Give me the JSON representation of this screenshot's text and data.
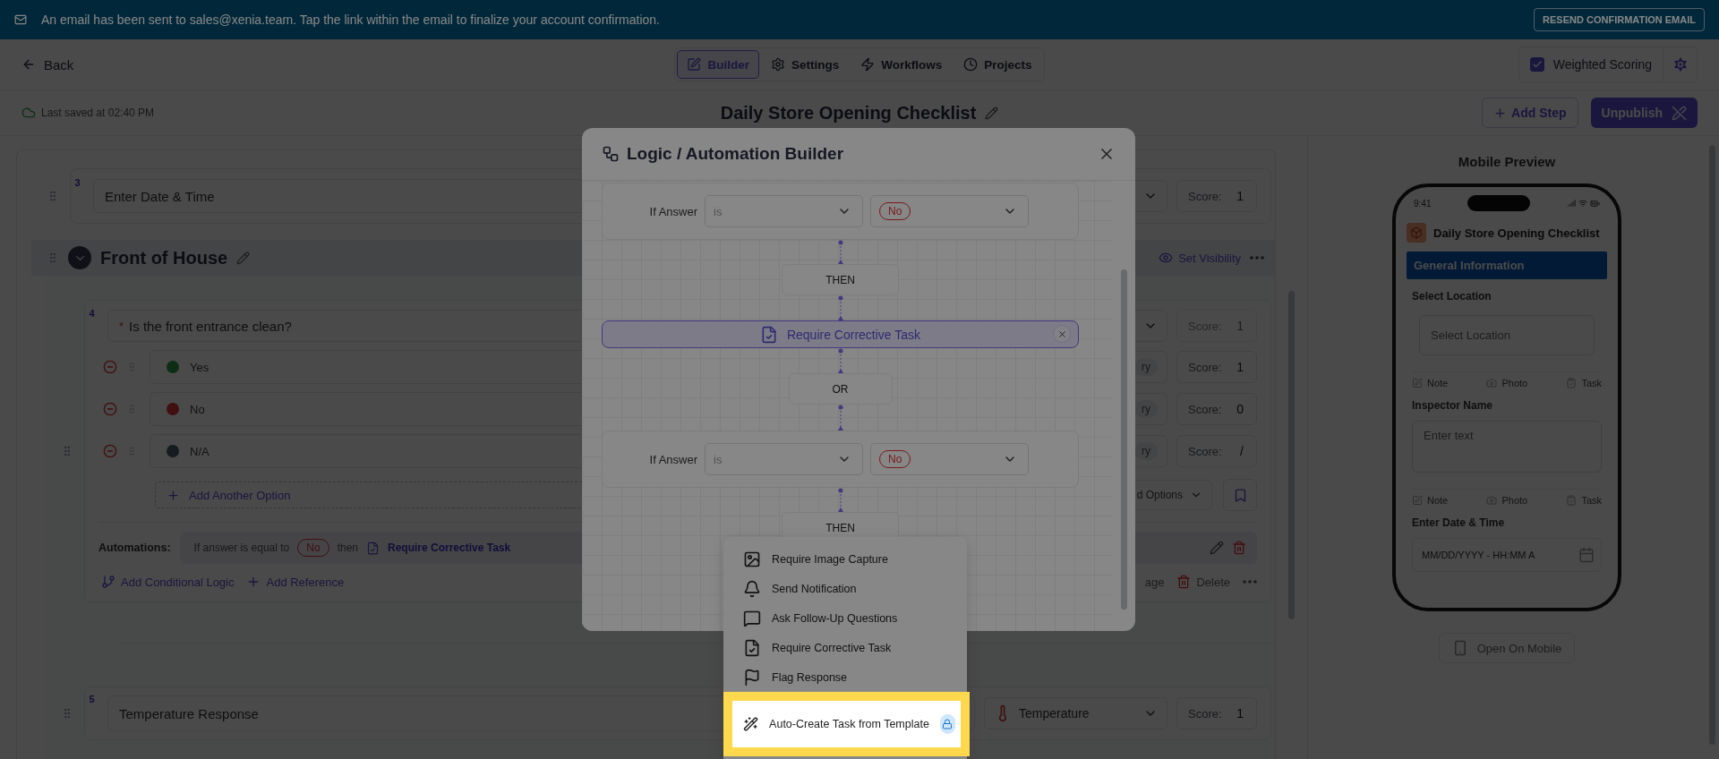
{
  "banner": {
    "message": "An email has been sent to sales@xenia.team. Tap the link within the email to finalize your account confirmation.",
    "button": "RESEND CONFIRMATION EMAIL"
  },
  "header": {
    "back": "Back",
    "tabs": [
      {
        "label": "Builder",
        "selected": true
      },
      {
        "label": "Settings",
        "selected": false
      },
      {
        "label": "Workflows",
        "selected": false
      },
      {
        "label": "Projects",
        "selected": false
      }
    ],
    "weighted_scoring": {
      "label": "Weighted Scoring",
      "checked": true
    }
  },
  "title_bar": {
    "last_saved": "Last saved at 02:40 PM",
    "title": "Daily Store Opening Checklist",
    "add_step": "Add Step",
    "unpublish": "Unpublish"
  },
  "builder": {
    "date_question": {
      "number": "3",
      "text": "Enter Date & Time",
      "score_label": "Score:",
      "score": "1",
      "score_disabled": false
    },
    "section": {
      "title": "Front of House",
      "visibility": "Set Visibility"
    },
    "entrance_question": {
      "number": "4",
      "required_mark": "*",
      "text": "Is the front entrance clean?",
      "score_label": "Score:",
      "score": "1",
      "score_disabled": true,
      "options": [
        {
          "label": "Yes",
          "color": "#0e2e14",
          "category": "ry",
          "score_label": "Score:",
          "score": "1"
        },
        {
          "label": "No",
          "color": "#411010",
          "category": "ry",
          "score_label": "Score:",
          "score": "0"
        },
        {
          "label": "N/A",
          "color": "#161d21",
          "category": "ry",
          "score_label": "Score:",
          "score": "/"
        }
      ],
      "add_option": "Add Another Option",
      "options_menu": "d Options",
      "automations_label": "Automations:",
      "automation": {
        "condition": "If answer is equal to",
        "answer": "No",
        "joiner": "then",
        "action": "Require Corrective Task"
      },
      "add_logic": "Add Conditional Logic",
      "add_reference": "Add Reference",
      "image_action": "age",
      "delete": "Delete"
    },
    "temperature_question": {
      "number": "5",
      "text": "Temperature Response",
      "type": "Temperature",
      "score_label": "Score:",
      "score": "1",
      "score_disabled": false
    }
  },
  "mobile_preview": {
    "heading": "Mobile Preview",
    "time": "9:41",
    "app_title": "Daily Store Opening Checklist",
    "section": "General Information",
    "fields": [
      {
        "kind": "select",
        "label": "Select Location",
        "placeholder": "Select Location",
        "actions": [
          "Note",
          "Photo",
          "Task"
        ]
      },
      {
        "kind": "textarea",
        "label": "Inspector Name",
        "placeholder": "Enter text",
        "actions": [
          "Note",
          "Photo",
          "Task"
        ]
      },
      {
        "kind": "datetime",
        "label": "Enter Date & Time",
        "placeholder": "MM/DD/YYYY - HH:MM A"
      }
    ],
    "open_button": "Open On Mobile"
  },
  "modal": {
    "title": "Logic / Automation Builder",
    "flow": [
      {
        "kind": "condition",
        "label": "If Answer",
        "operator": "is",
        "answer": "No"
      },
      {
        "kind": "step",
        "label": "THEN"
      },
      {
        "kind": "action",
        "label": "Require Corrective Task"
      },
      {
        "kind": "step",
        "label": "OR"
      },
      {
        "kind": "condition",
        "label": "If Answer",
        "operator": "is",
        "answer": "No"
      },
      {
        "kind": "step",
        "label": "THEN"
      }
    ]
  },
  "action_menu": {
    "items": [
      {
        "label": "Require Image Capture",
        "selected": false,
        "locked": false
      },
      {
        "label": "Send Notification",
        "selected": false,
        "locked": false
      },
      {
        "label": "Ask Follow-Up Questions",
        "selected": false,
        "locked": false
      },
      {
        "label": "Require Corrective Task",
        "selected": false,
        "locked": false
      },
      {
        "label": "Flag Response",
        "selected": false,
        "locked": false
      },
      {
        "label": "Auto-Create Task from Template",
        "selected": true,
        "locked": true
      }
    ]
  }
}
